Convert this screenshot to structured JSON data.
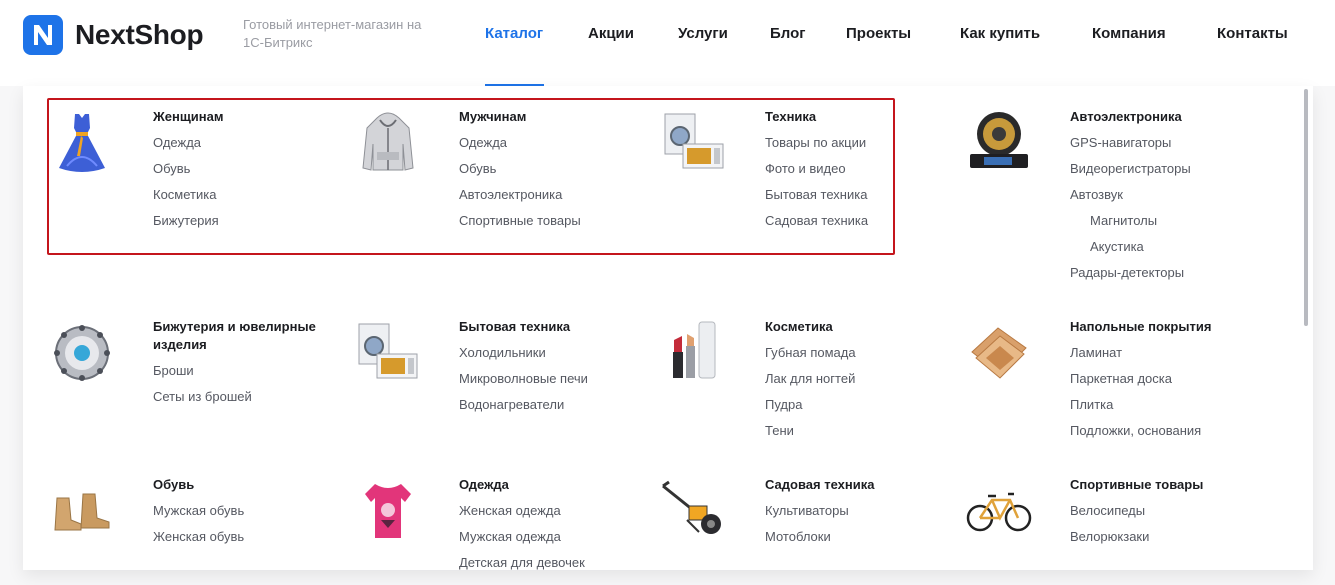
{
  "brand": {
    "name": "NextShop",
    "tagline": "Готовый интернет-магазин на 1С-Битрикс",
    "accent": "#1e73e8"
  },
  "nav": [
    "Каталог",
    "Акции",
    "Услуги",
    "Блог",
    "Проекты",
    "Как купить",
    "Компания",
    "Контакты"
  ],
  "catalog": [
    {
      "title": "Женщинам",
      "icon": "dress-icon",
      "links": [
        "Одежда",
        "Обувь",
        "Косметика",
        "Бижутерия"
      ]
    },
    {
      "title": "Мужчинам",
      "icon": "hoodie-icon",
      "links": [
        "Одежда",
        "Обувь",
        "Автоэлектроника",
        "Спортивные товары"
      ]
    },
    {
      "title": "Техника",
      "icon": "appliances-icon",
      "links": [
        "Товары по акции",
        "Фото и видео",
        "Бытовая техника",
        "Садовая техника"
      ]
    },
    {
      "title": "Автоэлектроника",
      "icon": "car-audio-icon",
      "links": [
        "GPS-навигаторы",
        "Видеорегистраторы",
        "Автозвук",
        "Магнитолы",
        "Акустика",
        "Радары-детекторы"
      ]
    },
    {
      "title": "Бижутерия и ювелирные изделия",
      "icon": "brooch-icon",
      "links": [
        "Броши",
        "Сеты из брошей"
      ]
    },
    {
      "title": "Бытовая техника",
      "icon": "appliances-icon",
      "links": [
        "Холодильники",
        "Микроволновые печи",
        "Водонагреватели"
      ]
    },
    {
      "title": "Косметика",
      "icon": "cosmetics-icon",
      "links": [
        "Губная помада",
        "Лак для ногтей",
        "Пудра",
        "Тени"
      ]
    },
    {
      "title": "Напольные покрытия",
      "icon": "flooring-icon",
      "links": [
        "Ламинат",
        "Паркетная доска",
        "Плитка",
        "Подложки, основания"
      ]
    },
    {
      "title": "Обувь",
      "icon": "boots-icon",
      "links": [
        "Мужская обувь",
        "Женская обувь"
      ]
    },
    {
      "title": "Одежда",
      "icon": "tshirt-icon",
      "links": [
        "Женская одежда",
        "Мужская одежда",
        "Детская для девочек"
      ]
    },
    {
      "title": "Садовая техника",
      "icon": "cultivator-icon",
      "links": [
        "Культиваторы",
        "Мотоблоки"
      ]
    },
    {
      "title": "Спортивные товары",
      "icon": "bicycle-icon",
      "links": [
        "Велосипеды",
        "Велорюкзаки"
      ]
    }
  ]
}
